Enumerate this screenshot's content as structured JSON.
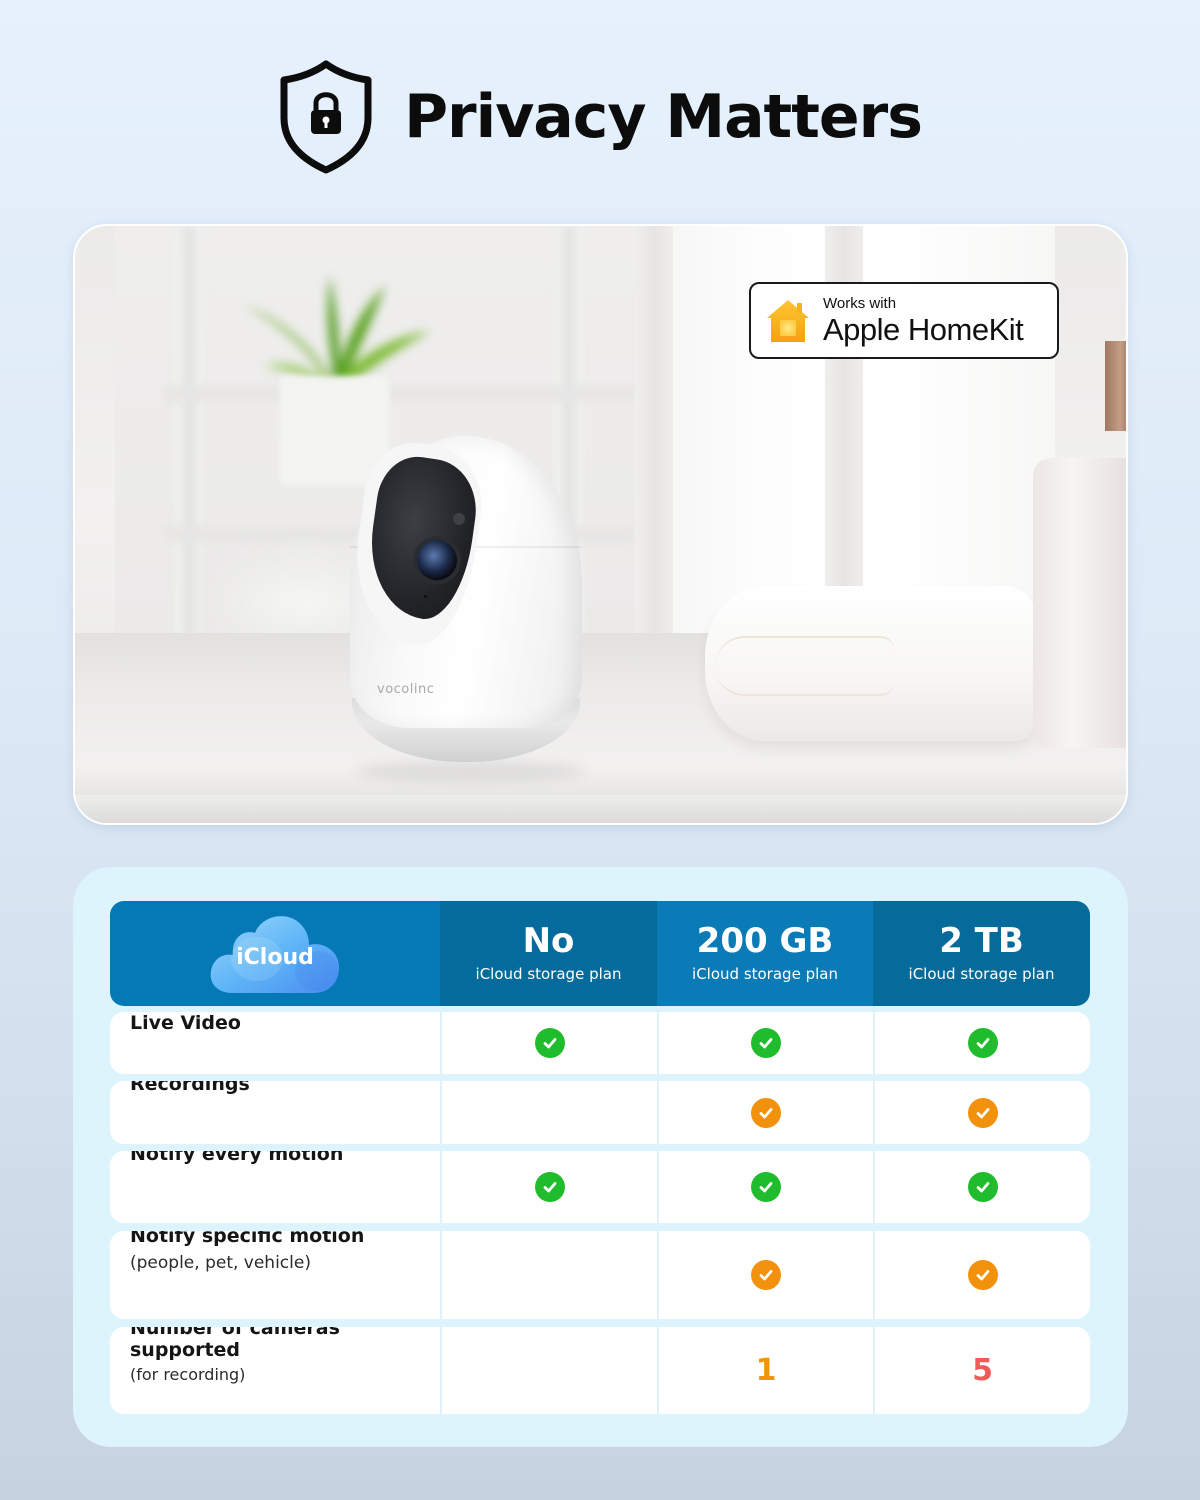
{
  "header": {
    "title": "Privacy Matters",
    "icon": "shield-lock-icon"
  },
  "photo": {
    "description": "Product photo: white pan-tilt indoor security camera on a bathroom counter beside a folded towel and soap dispenser",
    "camera_brand": "vocolinc",
    "badge": {
      "icon": "home-icon",
      "small_text": "Works with",
      "big_text": "Apple HomeKit"
    }
  },
  "comparison": {
    "header": {
      "logo_label": "iCloud",
      "plans": [
        {
          "title": "No",
          "subtitle": "iCloud storage plan"
        },
        {
          "title": "200 GB",
          "subtitle": "iCloud storage plan"
        },
        {
          "title": "2 TB",
          "subtitle": "iCloud storage plan"
        }
      ]
    },
    "colors": {
      "check_green": "#1fbd2e",
      "check_orange": "#f2920c",
      "number_orange": "#f2940f",
      "number_red": "#ef5b57",
      "header_light": "#0479b6",
      "header_dark": "#056a9c"
    },
    "rows": [
      {
        "label": "Live Video",
        "sublabel": "",
        "values": [
          "check-green",
          "check-green",
          "check-green"
        ]
      },
      {
        "label": "Recordings",
        "sublabel": "",
        "values": [
          "",
          "check-orange",
          "check-orange"
        ]
      },
      {
        "label": "Notify every motion",
        "sublabel": "",
        "values": [
          "check-green",
          "check-green",
          "check-green"
        ]
      },
      {
        "label": "Notify specific motion",
        "sublabel": "(people, pet, vehicle)",
        "values": [
          "",
          "check-orange",
          "check-orange"
        ]
      },
      {
        "label": "Number of cameras supported",
        "sublabel": "(for recording)",
        "values": [
          "",
          "1",
          "5"
        ]
      }
    ]
  }
}
